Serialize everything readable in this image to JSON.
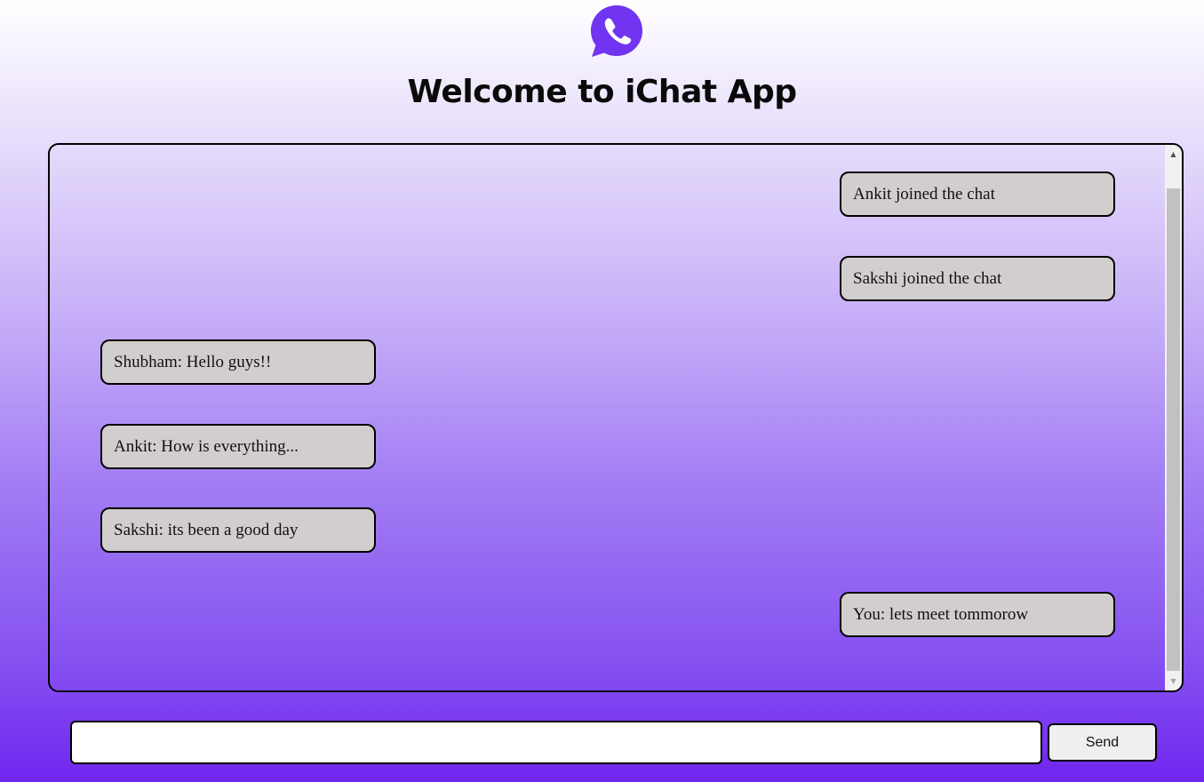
{
  "header": {
    "logo_icon": "whatsapp-style-phone-icon",
    "logo_color": "#7134f0",
    "title": "Welcome to iChat App"
  },
  "chat": {
    "messages": [
      {
        "text": "Ankit joined the chat",
        "position": "right"
      },
      {
        "text": "Sakshi joined the chat",
        "position": "right"
      },
      {
        "text": "Shubham: Hello guys!!",
        "position": "left"
      },
      {
        "text": "Ankit: How is everything...",
        "position": "left"
      },
      {
        "text": "Sakshi: its been a good day",
        "position": "left"
      },
      {
        "text": "You: lets meet tommorow",
        "position": "right"
      }
    ]
  },
  "composer": {
    "input_value": "",
    "input_placeholder": "",
    "send_label": "Send"
  },
  "colors": {
    "bubble": "#d3cece",
    "background_top": "#ffffff",
    "background_bottom": "#7026ef"
  }
}
